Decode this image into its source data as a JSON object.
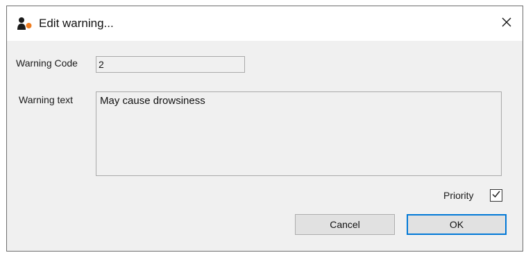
{
  "window": {
    "title": "Edit warning...",
    "icon": "app-figure-icon",
    "close_icon": "close-icon"
  },
  "form": {
    "warning_code": {
      "label": "Warning Code",
      "value": "2"
    },
    "warning_text": {
      "label": "Warning text",
      "value": "May cause drowsiness"
    },
    "priority": {
      "label": "Priority",
      "checked": true
    }
  },
  "buttons": {
    "cancel_label": "Cancel",
    "ok_label": "OK"
  },
  "colors": {
    "accent": "#0078d7",
    "icon_orange": "#f07c1e"
  }
}
